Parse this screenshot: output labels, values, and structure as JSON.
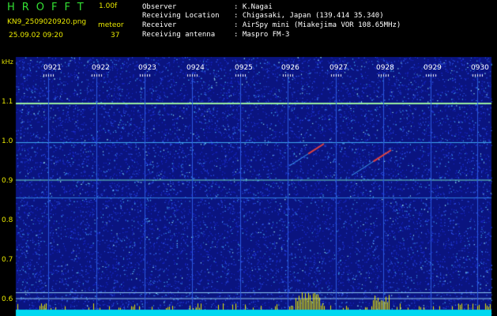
{
  "header": {
    "app_title": "HROFFT",
    "version": "1.00f",
    "filename": "KN9_2509020920.png",
    "meteor_label": "meteor",
    "datetime": "25.09.02 09:20",
    "meteor_count": "37",
    "observer_label": "Observer",
    "observer_value": ": K.Nagai",
    "location_label": "Receiving Location",
    "location_value": ": Chigasaki, Japan (139.414 35.340)",
    "receiver_label": "Receiver",
    "receiver_value": ": AirSpy mini (Miakejima VOR 108.65MHz)",
    "antenna_label": "Receiving antenna",
    "antenna_value": ": Maspro FM-3"
  },
  "axis": {
    "y_unit": "kHz",
    "y_ticks": [
      "1.1",
      "1.0",
      "0.9",
      "0.8",
      "0.7",
      "0.6"
    ],
    "x_ticks": [
      "0921",
      "0922",
      "0923",
      "0924",
      "0925",
      "0926",
      "0927",
      "0928",
      "0929",
      "0930"
    ]
  },
  "colors": {
    "background": "#000000",
    "noise_low": "#0b1a9a",
    "trace": "#e8e800",
    "baseline": "#00d8f0"
  }
}
